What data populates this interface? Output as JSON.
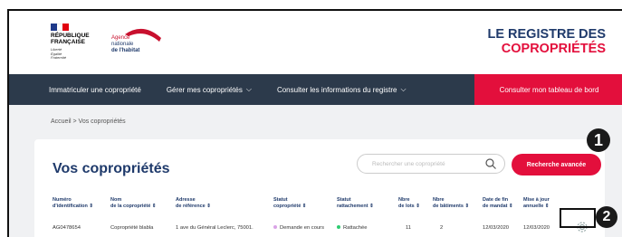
{
  "header": {
    "republique_lines": [
      "RÉPUBLIQUE",
      "FRANÇAISE"
    ],
    "motto": [
      "Liberté",
      "Égalité",
      "Fraternité"
    ],
    "anah_lines": [
      "Agence",
      "nationale",
      "de l'habitat"
    ],
    "registre_line1": "LE REGISTRE DES",
    "registre_line2": "COPROPRIÉTÉS"
  },
  "nav": {
    "item1": "Immatriculer une copropriété",
    "item2": "Gérer mes copropriétés",
    "item3": "Consulter les informations du registre",
    "cta": "Consulter mon tableau de bord"
  },
  "breadcrumb": "Accueil > Vos copropriétés",
  "main": {
    "title": "Vos copropriétés",
    "search_placeholder": "Rechercher une copropriété",
    "advanced_search": "Recherche avancée"
  },
  "table": {
    "headers": [
      [
        "Numéro",
        "d'identification ⇕"
      ],
      [
        "Nom",
        "de la copropriété ⇕"
      ],
      [
        "Adresse",
        "de référence ⇕"
      ],
      [
        "Statut",
        "copropriété ⇕"
      ],
      [
        "Statut",
        "rattachement ⇕"
      ],
      [
        "Nbre",
        "de lots ⇕"
      ],
      [
        "Nbre",
        "de bâtiments ⇕"
      ],
      [
        "Date de fin",
        "de mandat ⇕"
      ],
      [
        "Mise à jour",
        "annuelle ⇕"
      ]
    ],
    "row": {
      "id": "AG0478654",
      "name": "Copropriété blabla",
      "address": "1 ave du Général Leclerc, 75001.",
      "status": "Demande en cours",
      "attach": "Rattachée",
      "lots": "11",
      "buildings": "2",
      "end_date": "12/03/2020",
      "update": "12/03/2020"
    }
  },
  "callouts": {
    "one": "1",
    "two": "2"
  },
  "colors": {
    "navy": "#2c3a4b",
    "brand_red": "#e30f3c",
    "title_blue": "#1f3a6b",
    "status_pending": "#d9a3e6",
    "status_attached": "#2ecc71"
  }
}
